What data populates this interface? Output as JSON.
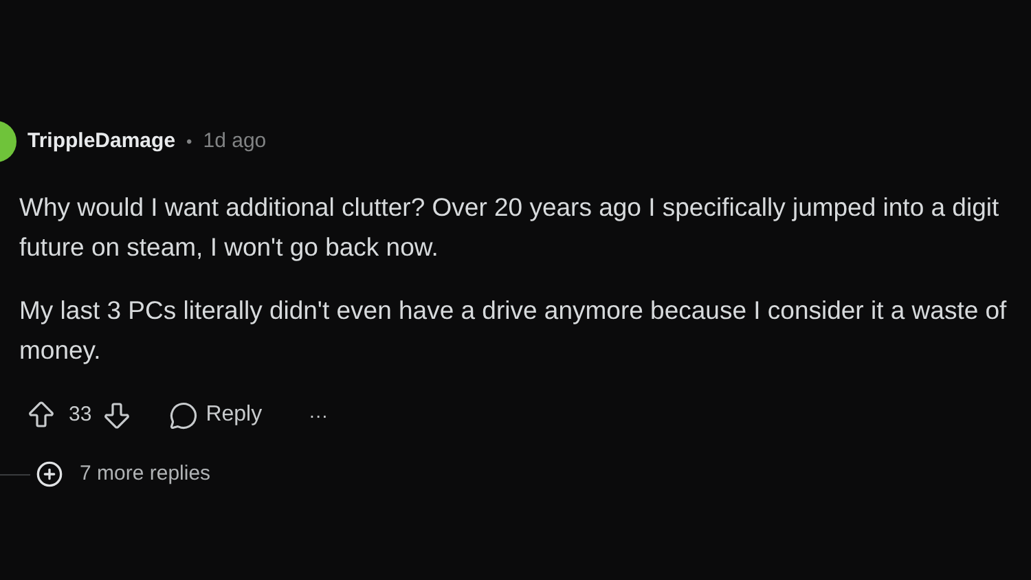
{
  "comment": {
    "author": "TrippleDamage",
    "separator": "•",
    "time": "1d ago",
    "paragraphs": [
      {
        "lines": [
          "Why would I want additional clutter? Over 20 years ago I specifically jumped into a digit",
          "future on steam, I won't go back now."
        ]
      },
      {
        "lines": [
          "My last 3 PCs literally didn't even have a drive anymore because I consider it a waste of",
          "money."
        ]
      }
    ],
    "votes": "33",
    "reply": "Reply",
    "more": "···",
    "more_replies": "7 more replies"
  }
}
